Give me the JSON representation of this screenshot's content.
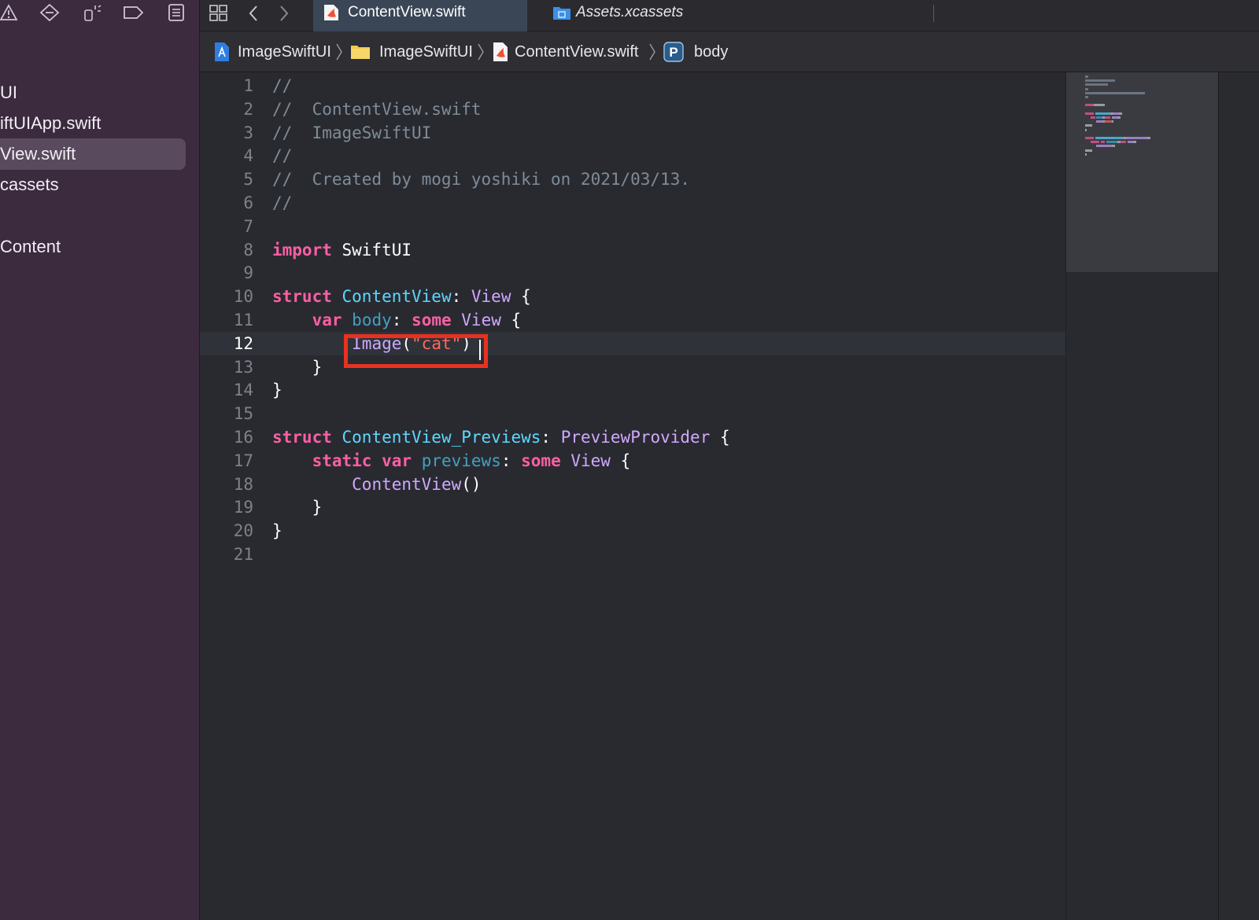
{
  "sidebar": {
    "files": [
      {
        "label": "UI"
      },
      {
        "label": "iftUIApp.swift"
      },
      {
        "label": "View.swift",
        "selected": true
      },
      {
        "label": "cassets"
      },
      {
        "label": "Content"
      }
    ],
    "toolbar_icons": [
      "warning-icon",
      "breakpoint-icon",
      "test-icon",
      "tag-icon",
      "report-icon"
    ]
  },
  "tabbar": {
    "tabs": [
      {
        "label": "ContentView.swift",
        "icon": "swift-file-icon",
        "active": true
      },
      {
        "label": "Assets.xcassets",
        "icon": "asset-catalog-icon",
        "active": false
      }
    ]
  },
  "breadcrumb": [
    {
      "label": "ImageSwiftUI",
      "icon": "project-icon"
    },
    {
      "label": "ImageSwiftUI",
      "icon": "folder-icon"
    },
    {
      "label": "ContentView.swift",
      "icon": "swift-file-icon"
    },
    {
      "label": "body",
      "icon": "property-icon",
      "icon_letter": "P"
    }
  ],
  "editor": {
    "current_line": 12,
    "lines": [
      {
        "n": "1",
        "t": [
          {
            "c": "comment",
            "s": "//"
          }
        ]
      },
      {
        "n": "2",
        "t": [
          {
            "c": "comment",
            "s": "//  ContentView.swift"
          }
        ]
      },
      {
        "n": "3",
        "t": [
          {
            "c": "comment",
            "s": "//  ImageSwiftUI"
          }
        ]
      },
      {
        "n": "4",
        "t": [
          {
            "c": "comment",
            "s": "//"
          }
        ]
      },
      {
        "n": "5",
        "t": [
          {
            "c": "comment",
            "s": "//  Created by mogi yoshiki on 2021/03/13."
          }
        ]
      },
      {
        "n": "6",
        "t": [
          {
            "c": "comment",
            "s": "//"
          }
        ]
      },
      {
        "n": "7",
        "t": []
      },
      {
        "n": "8",
        "t": [
          {
            "c": "keyword",
            "s": "import"
          },
          {
            "c": "plain",
            "s": " SwiftUI"
          }
        ]
      },
      {
        "n": "9",
        "t": []
      },
      {
        "n": "10",
        "t": [
          {
            "c": "keyword",
            "s": "struct"
          },
          {
            "c": "plain",
            "s": " "
          },
          {
            "c": "type",
            "s": "ContentView"
          },
          {
            "c": "plain",
            "s": ": "
          },
          {
            "c": "typeref",
            "s": "View"
          },
          {
            "c": "plain",
            "s": " {"
          }
        ]
      },
      {
        "n": "11",
        "t": [
          {
            "c": "plain",
            "s": "    "
          },
          {
            "c": "keyword",
            "s": "var"
          },
          {
            "c": "plain",
            "s": " "
          },
          {
            "c": "var",
            "s": "body"
          },
          {
            "c": "plain",
            "s": ": "
          },
          {
            "c": "keyword",
            "s": "some"
          },
          {
            "c": "plain",
            "s": " "
          },
          {
            "c": "typeref",
            "s": "View"
          },
          {
            "c": "plain",
            "s": " {"
          }
        ]
      },
      {
        "n": "12",
        "t": [
          {
            "c": "plain",
            "s": "        "
          },
          {
            "c": "call",
            "s": "Image"
          },
          {
            "c": "plain",
            "s": "("
          },
          {
            "c": "string",
            "s": "\"cat\""
          },
          {
            "c": "plain",
            "s": ")"
          }
        ]
      },
      {
        "n": "13",
        "t": [
          {
            "c": "plain",
            "s": "    }"
          }
        ]
      },
      {
        "n": "14",
        "t": [
          {
            "c": "plain",
            "s": "}"
          }
        ]
      },
      {
        "n": "15",
        "t": []
      },
      {
        "n": "16",
        "t": [
          {
            "c": "keyword",
            "s": "struct"
          },
          {
            "c": "plain",
            "s": " "
          },
          {
            "c": "type",
            "s": "ContentView_Previews"
          },
          {
            "c": "plain",
            "s": ": "
          },
          {
            "c": "typeref",
            "s": "PreviewProvider"
          },
          {
            "c": "plain",
            "s": " {"
          }
        ]
      },
      {
        "n": "17",
        "t": [
          {
            "c": "plain",
            "s": "    "
          },
          {
            "c": "keyword",
            "s": "static"
          },
          {
            "c": "plain",
            "s": " "
          },
          {
            "c": "keyword",
            "s": "var"
          },
          {
            "c": "plain",
            "s": " "
          },
          {
            "c": "var",
            "s": "previews"
          },
          {
            "c": "plain",
            "s": ": "
          },
          {
            "c": "keyword",
            "s": "some"
          },
          {
            "c": "plain",
            "s": " "
          },
          {
            "c": "typeref",
            "s": "View"
          },
          {
            "c": "plain",
            "s": " {"
          }
        ]
      },
      {
        "n": "18",
        "t": [
          {
            "c": "plain",
            "s": "        "
          },
          {
            "c": "call",
            "s": "ContentView"
          },
          {
            "c": "plain",
            "s": "()"
          }
        ]
      },
      {
        "n": "19",
        "t": [
          {
            "c": "plain",
            "s": "    }"
          }
        ]
      },
      {
        "n": "20",
        "t": [
          {
            "c": "plain",
            "s": "}"
          }
        ]
      },
      {
        "n": "21",
        "t": []
      }
    ]
  },
  "colors": {
    "sidebar_bg": "#3c2a3f",
    "editor_bg": "#292a30",
    "highlight_box": "#e8321f",
    "keyword": "#fc5fa3",
    "type_decl": "#5dd8ff",
    "type_ref": "#d0a8ff",
    "string": "#fc6a5d",
    "comment": "#7f8c98"
  }
}
